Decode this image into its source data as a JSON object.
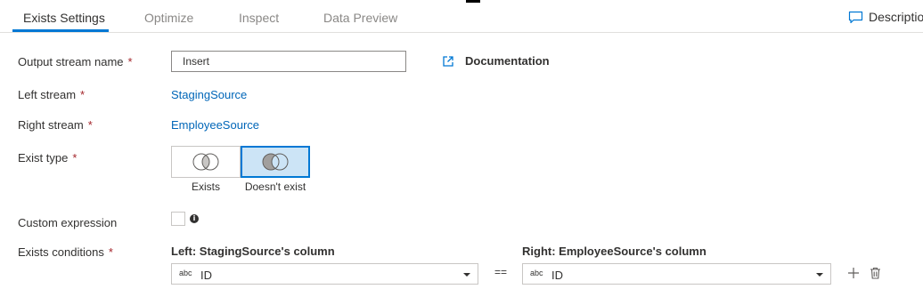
{
  "tabs": [
    {
      "label": "Exists Settings",
      "active": true
    },
    {
      "label": "Optimize",
      "active": false
    },
    {
      "label": "Inspect",
      "active": false
    },
    {
      "label": "Data Preview",
      "active": false
    }
  ],
  "description_label": "Descriptio",
  "form": {
    "output_stream": {
      "label": "Output stream name",
      "required_mark": "*",
      "value": "Insert"
    },
    "documentation_label": "Documentation",
    "left_stream": {
      "label": "Left stream",
      "required_mark": "*",
      "value": "StagingSource"
    },
    "right_stream": {
      "label": "Right stream",
      "required_mark": "*",
      "value": "EmployeeSource"
    },
    "exist_type": {
      "label": "Exist type",
      "required_mark": "*",
      "options": [
        "Exists",
        "Doesn't exist"
      ],
      "selected": "Doesn't exist"
    },
    "custom_expression": {
      "label": "Custom expression",
      "checked": false,
      "info_glyph": "i"
    },
    "exists_conditions": {
      "label": "Exists conditions",
      "required_mark": "*",
      "left_header": "Left: StagingSource's column",
      "right_header": "Right: EmployeeSource's column",
      "operator": "==",
      "left": {
        "type_badge": "abc",
        "value": "ID"
      },
      "right": {
        "type_badge": "abc",
        "value": "ID"
      }
    }
  },
  "icons": {
    "description": "comment-icon",
    "documentation": "external-link-icon",
    "add": "plus-icon",
    "delete": "trash-icon"
  },
  "colors": {
    "accent": "#0078d4",
    "link": "#0066b8",
    "required": "#a4262c",
    "selected_fill": "#cce4f6"
  }
}
